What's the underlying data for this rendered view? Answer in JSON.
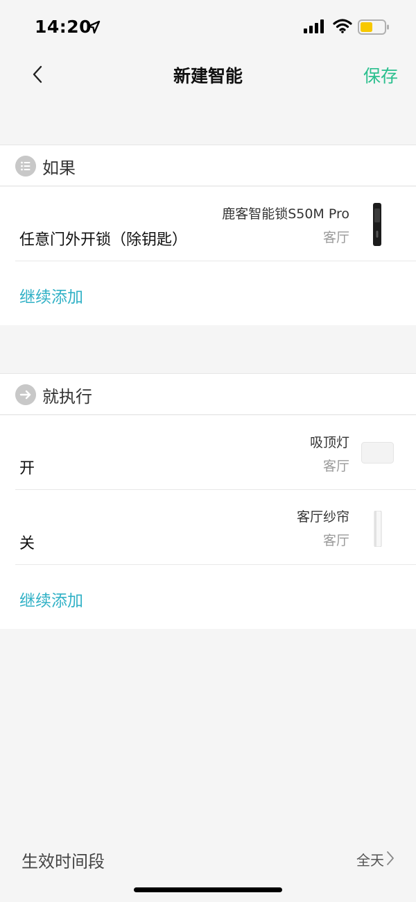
{
  "status": {
    "time": "14:20",
    "icons": [
      "location-arrow-icon",
      "signal-icon",
      "wifi-icon",
      "battery-icon"
    ],
    "battery_color": "#f7c800"
  },
  "nav": {
    "back_icon": "chevron-left-icon",
    "title": "新建智能",
    "save_label": "保存",
    "save_color": "#2bbf8e"
  },
  "if_section": {
    "title": "如果",
    "icon": "list-icon",
    "conditions": [
      {
        "action": "任意门外开锁（除钥匙）",
        "device": "鹿客智能锁S50M Pro",
        "room": "客厅",
        "thumb": "smart-lock-thumbnail"
      }
    ],
    "add_more": "继续添加"
  },
  "then_section": {
    "title": "就执行",
    "icon": "arrow-right-circle-icon",
    "actions": [
      {
        "action": "开",
        "device": "吸顶灯",
        "room": "客厅",
        "thumb": "ceiling-light-thumbnail"
      },
      {
        "action": "关",
        "device": "客厅纱帘",
        "room": "客厅",
        "thumb": "curtain-thumbnail"
      }
    ],
    "add_more": "继续添加",
    "accent": "#31b1c6"
  },
  "time_period": {
    "label": "生效时间段",
    "value": "全天",
    "icon": "chevron-right-icon"
  }
}
